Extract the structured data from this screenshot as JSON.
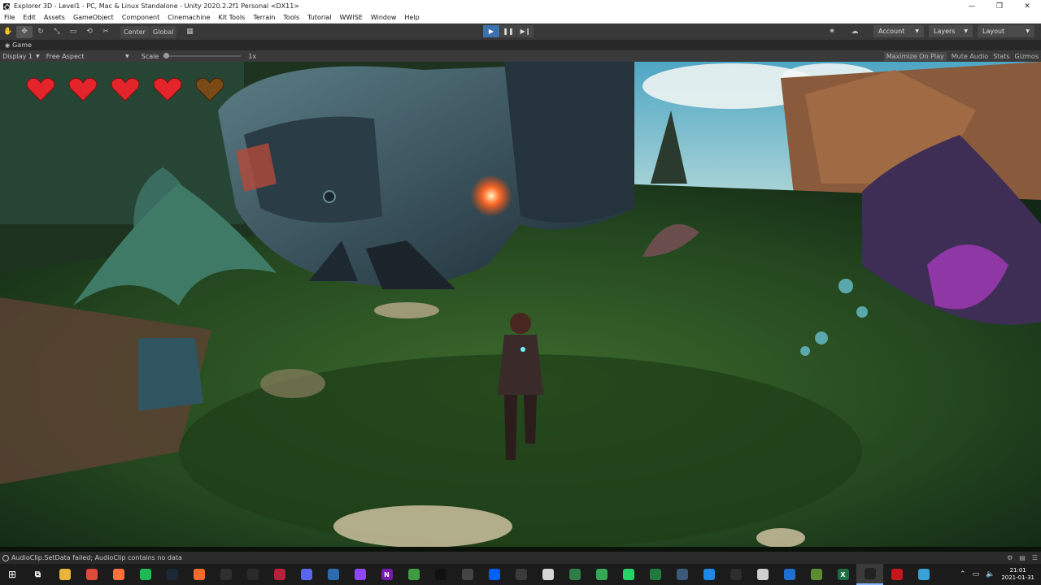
{
  "window": {
    "title": "Explorer 3D - Level1 - PC, Mac & Linux Standalone - Unity 2020.2.2f1 Personal <DX11>",
    "minimize": "—",
    "maximize": "❐",
    "close": "✕"
  },
  "menu": [
    "File",
    "Edit",
    "Assets",
    "GameObject",
    "Component",
    "Cinemachine",
    "Kit Tools",
    "Terrain",
    "Tools",
    "Tutorial",
    "WWISE",
    "Window",
    "Help"
  ],
  "toolbar": {
    "tools": [
      {
        "icon": "hand-icon",
        "glyph": "✋"
      },
      {
        "icon": "move-icon",
        "glyph": "✥"
      },
      {
        "icon": "rotate-icon",
        "glyph": "↻"
      },
      {
        "icon": "scale-icon",
        "glyph": "⤡"
      },
      {
        "icon": "rect-icon",
        "glyph": "▭"
      },
      {
        "icon": "transform-icon",
        "glyph": "⟲"
      },
      {
        "icon": "custom-tool-icon",
        "glyph": "✂"
      }
    ],
    "pivot_label": "Center",
    "space_label": "Global",
    "play_glyph": "▶",
    "pause_glyph": "❚❚",
    "step_glyph": "▶❙",
    "account_label": "Account",
    "layers_label": "Layers",
    "layout_label": "Layout"
  },
  "game_tab": {
    "label": "Game",
    "display": "Display 1",
    "aspect": "Free Aspect",
    "scale_label": "Scale",
    "scale_value": "1x",
    "maximize_on_play": "Maximize On Play",
    "mute_audio": "Mute Audio",
    "stats": "Stats",
    "gizmos": "Gizmos"
  },
  "hud": {
    "hearts_total": 5,
    "hearts_full": 4,
    "full_color": "#e3252b",
    "empty_color": "#7a4a16"
  },
  "status": {
    "message": "AudioClip.SetData failed; AudioClip contains no data"
  },
  "taskbar": {
    "apps": [
      {
        "name": "file-explorer-icon",
        "color": "#e8b43a",
        "glyph": ""
      },
      {
        "name": "chrome-icon",
        "color": "#dd4b39",
        "glyph": ""
      },
      {
        "name": "firefox-icon",
        "color": "#ff7139",
        "glyph": ""
      },
      {
        "name": "spotify-icon",
        "color": "#1db954",
        "glyph": ""
      },
      {
        "name": "steam-icon",
        "color": "#1b2838",
        "glyph": ""
      },
      {
        "name": "origin-icon",
        "color": "#f56c2d",
        "glyph": ""
      },
      {
        "name": "obs-icon",
        "color": "#302e31",
        "glyph": ""
      },
      {
        "name": "epic-games-icon",
        "color": "#2a2a2a",
        "glyph": ""
      },
      {
        "name": "dzl-icon",
        "color": "#b3213c",
        "glyph": ""
      },
      {
        "name": "discord-icon",
        "color": "#5865f2",
        "glyph": ""
      },
      {
        "name": "uplay-icon",
        "color": "#2b6cb0",
        "glyph": ""
      },
      {
        "name": "twitch-icon",
        "color": "#9146ff",
        "glyph": ""
      },
      {
        "name": "onenote-icon",
        "color": "#7719aa",
        "glyph": "N"
      },
      {
        "name": "greenshot-icon",
        "color": "#3f9b3f",
        "glyph": ""
      },
      {
        "name": "unreal-icon",
        "color": "#111111",
        "glyph": ""
      },
      {
        "name": "unity-hub-icon",
        "color": "#444444",
        "glyph": ""
      },
      {
        "name": "dropbox-icon",
        "color": "#0061ff",
        "glyph": ""
      },
      {
        "name": "vlc-icon",
        "color": "#3a3a3a",
        "glyph": ""
      },
      {
        "name": "notepad-icon",
        "color": "#d7d7d7",
        "glyph": ""
      },
      {
        "name": "kitbash-icon",
        "color": "#2d7d46",
        "glyph": ""
      },
      {
        "name": "maps-icon",
        "color": "#34a853",
        "glyph": ""
      },
      {
        "name": "whatsapp-icon",
        "color": "#25d366",
        "glyph": ""
      },
      {
        "name": "stats-icon",
        "color": "#1e7b3c",
        "glyph": ""
      },
      {
        "name": "davinci-icon",
        "color": "#3b5a7a",
        "glyph": ""
      },
      {
        "name": "screen-icon",
        "color": "#1e88e5",
        "glyph": ""
      },
      {
        "name": "udk-icon",
        "color": "#2d2d2d",
        "glyph": ""
      },
      {
        "name": "photos-icon",
        "color": "#cfcfcf",
        "glyph": ""
      },
      {
        "name": "edge-icon",
        "color": "#1f6fd0",
        "glyph": ""
      },
      {
        "name": "minecraft-icon",
        "color": "#5b8c32",
        "glyph": ""
      },
      {
        "name": "excel-icon",
        "color": "#1d6f42",
        "glyph": "X"
      },
      {
        "name": "unity-icon",
        "color": "#222222",
        "glyph": ""
      },
      {
        "name": "redshift-icon",
        "color": "#c4161c",
        "glyph": ""
      },
      {
        "name": "network-app-icon",
        "color": "#3aa0d8",
        "glyph": ""
      }
    ],
    "active_app": "unity-icon",
    "time": "21:01",
    "date": "2021-01-31"
  }
}
